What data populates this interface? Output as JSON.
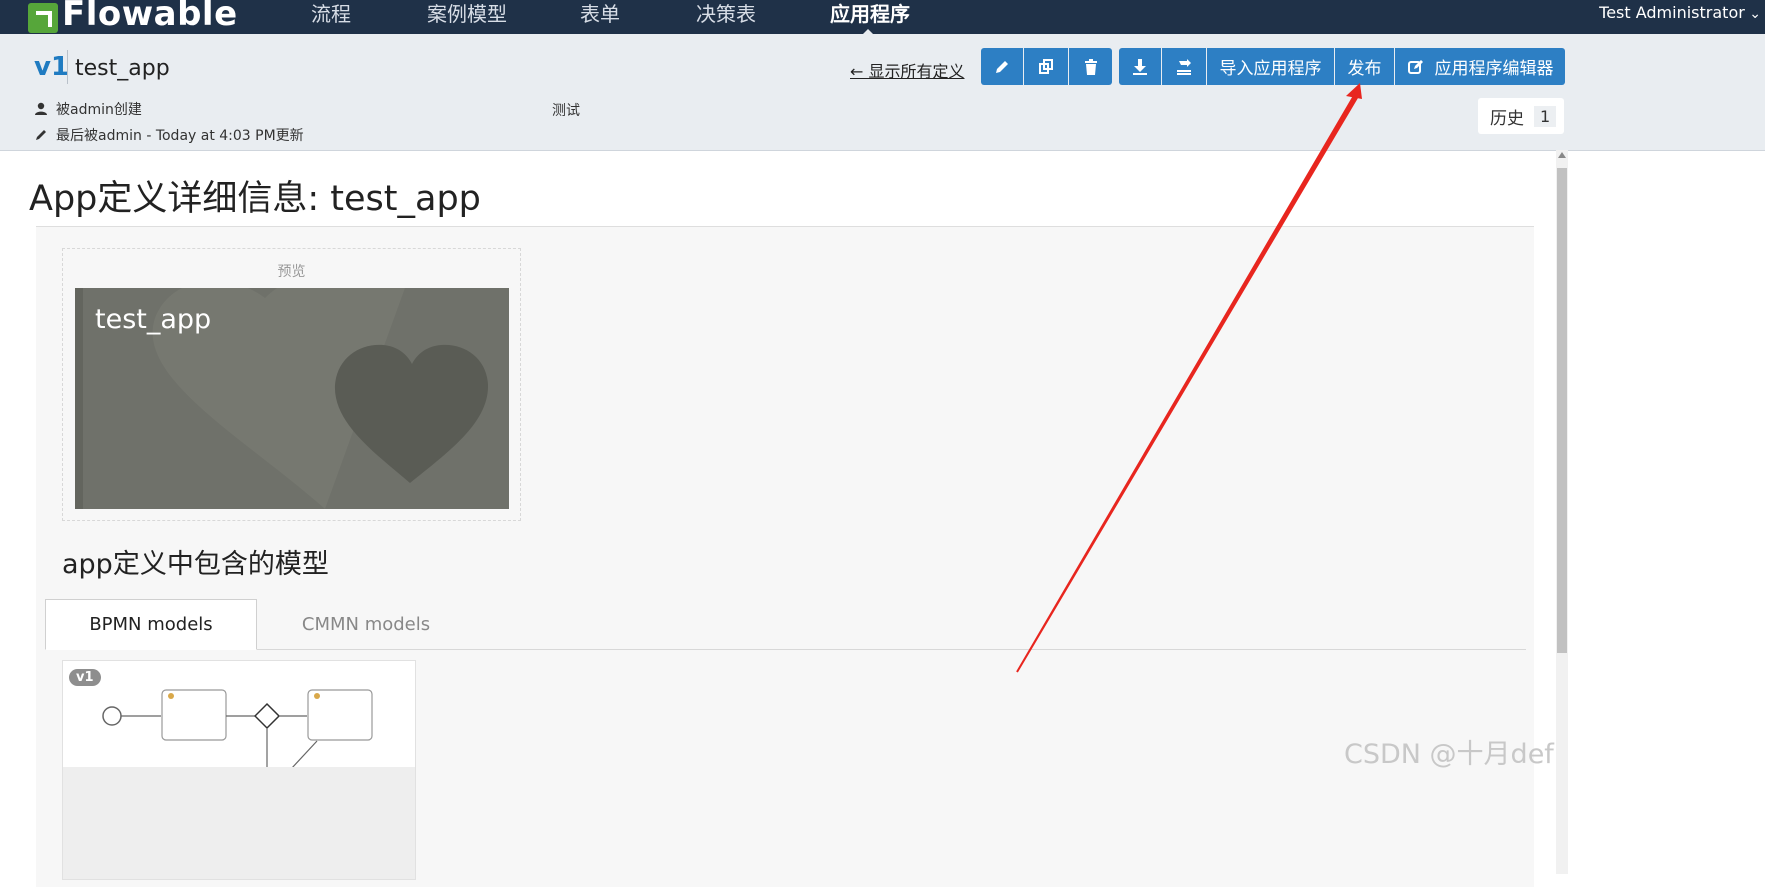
{
  "app": {
    "brand": "Flowable"
  },
  "nav": {
    "items": [
      "流程",
      "案例模型",
      "表单",
      "决策表",
      "应用程序"
    ],
    "active": "应用程序",
    "user": "Test Administrator"
  },
  "header": {
    "version": "v1",
    "name": "test_app",
    "created_by": "被admin创建",
    "updated_by": "最后被admin - Today at 4:03 PM更新",
    "description": "测试",
    "show_all": "← 显示所有定义",
    "buttons": {
      "import": "导入应用程序",
      "publish": "发布",
      "editor": "应用程序编辑器"
    },
    "history_label": "历史",
    "history_count": "1"
  },
  "main": {
    "title": "App定义详细信息: test_app",
    "preview_label": "预览",
    "tile_name": "test_app",
    "models_title": "app定义中包含的模型",
    "tabs": [
      "BPMN models",
      "CMMN models"
    ],
    "model_version": "v1"
  },
  "watermark": "CSDN @十月def",
  "colors": {
    "nav_bg": "#1f3148",
    "button": "#2d7fc4",
    "tile": "#6f716a",
    "arrow": "#e8261f"
  }
}
